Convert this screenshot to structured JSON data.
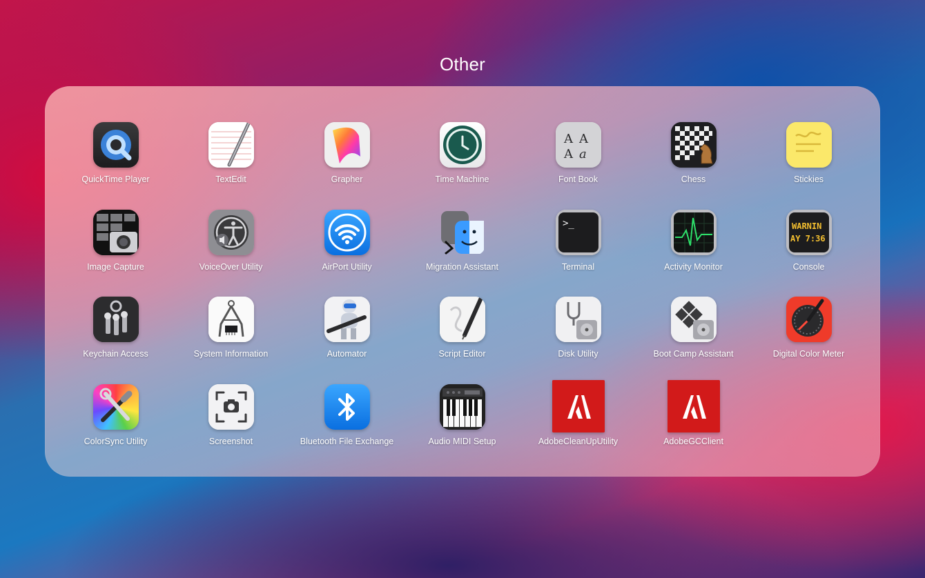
{
  "folder": {
    "title": "Other"
  },
  "apps": [
    {
      "id": "quicktime-player",
      "label": "QuickTime Player",
      "icon": "quicktime-icon"
    },
    {
      "id": "textedit",
      "label": "TextEdit",
      "icon": "textedit-icon"
    },
    {
      "id": "grapher",
      "label": "Grapher",
      "icon": "grapher-icon"
    },
    {
      "id": "time-machine",
      "label": "Time Machine",
      "icon": "time-machine-icon"
    },
    {
      "id": "font-book",
      "label": "Font Book",
      "icon": "font-book-icon"
    },
    {
      "id": "chess",
      "label": "Chess",
      "icon": "chess-icon"
    },
    {
      "id": "stickies",
      "label": "Stickies",
      "icon": "stickies-icon"
    },
    {
      "id": "image-capture",
      "label": "Image Capture",
      "icon": "image-capture-icon"
    },
    {
      "id": "voiceover-utility",
      "label": "VoiceOver Utility",
      "icon": "voiceover-icon"
    },
    {
      "id": "airport-utility",
      "label": "AirPort Utility",
      "icon": "airport-icon"
    },
    {
      "id": "migration-assistant",
      "label": "Migration Assistant",
      "icon": "migration-assistant-icon"
    },
    {
      "id": "terminal",
      "label": "Terminal",
      "icon": "terminal-icon"
    },
    {
      "id": "activity-monitor",
      "label": "Activity Monitor",
      "icon": "activity-monitor-icon"
    },
    {
      "id": "console",
      "label": "Console",
      "icon": "console-icon",
      "icon_text": [
        "WARNIN",
        "AY 7:36"
      ]
    },
    {
      "id": "keychain-access",
      "label": "Keychain Access",
      "icon": "keychain-icon"
    },
    {
      "id": "system-information",
      "label": "System Information",
      "icon": "system-information-icon"
    },
    {
      "id": "automator",
      "label": "Automator",
      "icon": "automator-icon"
    },
    {
      "id": "script-editor",
      "label": "Script Editor",
      "icon": "script-editor-icon"
    },
    {
      "id": "disk-utility",
      "label": "Disk Utility",
      "icon": "disk-utility-icon"
    },
    {
      "id": "boot-camp-assistant",
      "label": "Boot Camp Assistant",
      "icon": "boot-camp-icon"
    },
    {
      "id": "digital-color-meter",
      "label": "Digital Color Meter",
      "icon": "color-meter-icon"
    },
    {
      "id": "colorsync-utility",
      "label": "ColorSync Utility",
      "icon": "colorsync-icon"
    },
    {
      "id": "screenshot",
      "label": "Screenshot",
      "icon": "screenshot-icon"
    },
    {
      "id": "bluetooth-file-exchange",
      "label": "Bluetooth File Exchange",
      "icon": "bluetooth-icon"
    },
    {
      "id": "audio-midi-setup",
      "label": "Audio MIDI Setup",
      "icon": "piano-keyboard-icon"
    },
    {
      "id": "adobe-clean-up-utility",
      "label": "AdobeCleanUpUtility",
      "icon": "adobe-logo-icon"
    },
    {
      "id": "adobe-gc-client",
      "label": "AdobeGCClient",
      "icon": "adobe-logo-icon"
    }
  ],
  "colors": {
    "label_text": "#ffffff",
    "adobe_red": "#d21a1a"
  }
}
